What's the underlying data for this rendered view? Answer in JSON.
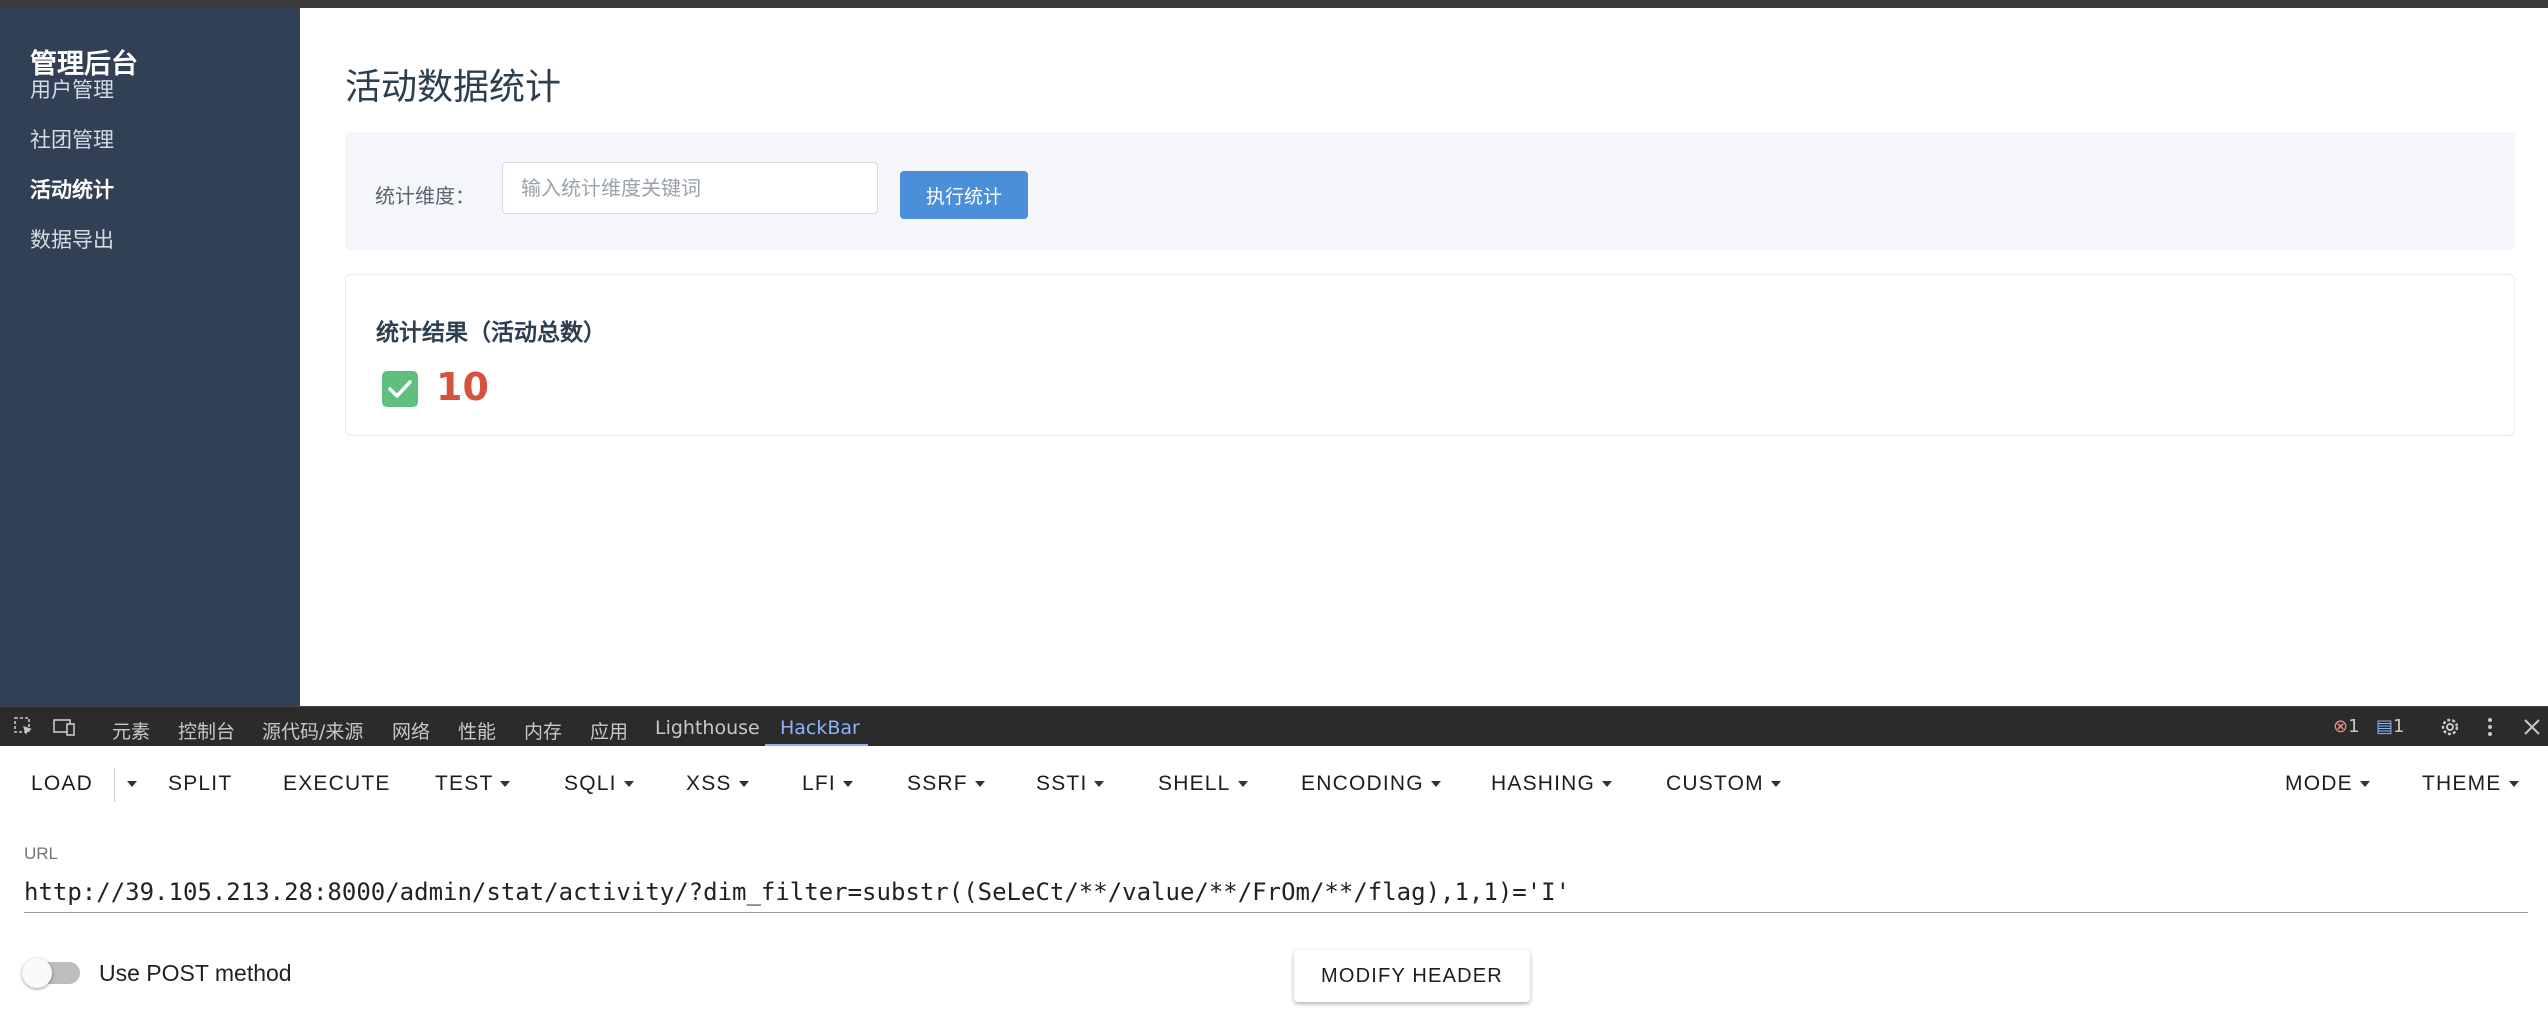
{
  "sidebar": {
    "brand": "管理后台",
    "items": [
      {
        "label": "用户管理"
      },
      {
        "label": "社团管理"
      },
      {
        "label": "活动统计"
      },
      {
        "label": "数据导出"
      }
    ]
  },
  "main": {
    "title": "活动数据统计",
    "filter": {
      "label": "统计维度：",
      "placeholder": "输入统计维度关键词",
      "button": "执行统计"
    },
    "result": {
      "title": "统计结果（活动总数）",
      "icon": "check-mark-icon",
      "value": "10"
    }
  },
  "devtools": {
    "tabs": [
      "元素",
      "控制台",
      "源代码/来源",
      "网络",
      "性能",
      "内存",
      "应用",
      "Lighthouse",
      "HackBar"
    ],
    "active_tab": "HackBar",
    "error_count": "1",
    "message_count": "1"
  },
  "hackbar": {
    "buttons": [
      "LOAD",
      "SPLIT",
      "EXECUTE",
      "TEST",
      "SQLI",
      "XSS",
      "LFI",
      "SSRF",
      "SSTI",
      "SHELL",
      "ENCODING",
      "HASHING",
      "CUSTOM",
      "MODE",
      "THEME"
    ],
    "url_label": "URL",
    "url_value": "http://39.105.213.28:8000/admin/stat/activity/?dim_filter=substr((SeLeCt/**/value/**/FrOm/**/flag),1,1)='I'",
    "post_label": "Use POST method",
    "post_enabled": false,
    "modify_header": "MODIFY HEADER"
  },
  "colors": {
    "sidebar_bg": "#324055",
    "accent_button": "#4a8fd7",
    "result_value": "#d3533f",
    "devtools_active_tab": "#8ab4f8"
  }
}
